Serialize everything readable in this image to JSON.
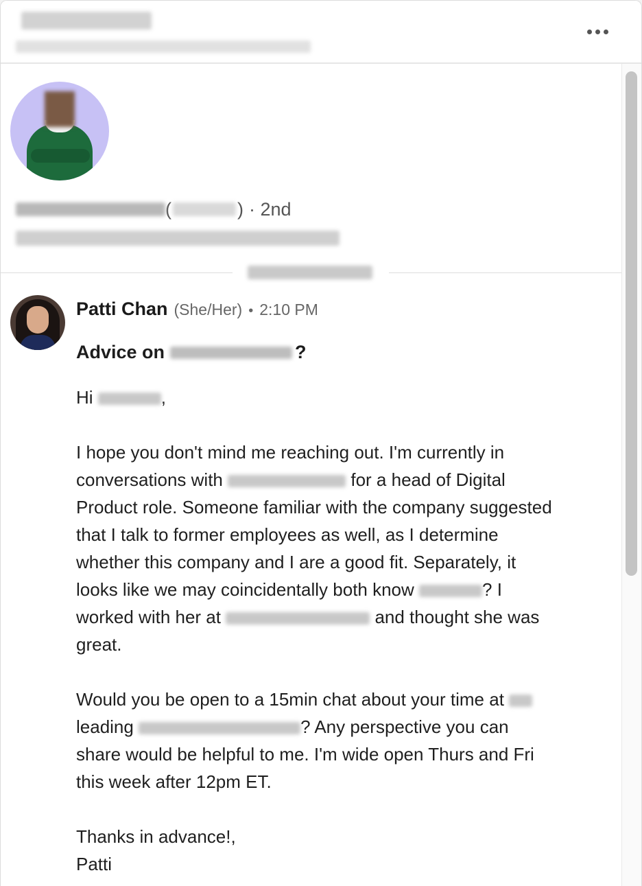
{
  "header": {
    "more_icon": "more-horizontal-icon"
  },
  "profile": {
    "degree": "· 2nd",
    "open_paren": "(",
    "close_paren": ")"
  },
  "message": {
    "sender_name": "Patti Chan",
    "sender_pronouns": "(She/Her)",
    "separator": "•",
    "time": "2:10 PM",
    "subject_prefix": "Advice on",
    "subject_suffix": "?",
    "greeting_prefix": "Hi",
    "greeting_suffix": ",",
    "p1_a": "I hope you don't mind me reaching out. I'm currently in conversations with",
    "p1_b": "for a head of Digital Product role. Someone familiar with the company suggested that I talk to former employees as well, as I determine whether this company and I are a good fit. Separately, it looks like we may coincidentally both know",
    "p1_c": "? I worked with her at",
    "p1_d": "and thought she was great.",
    "p2_a": "Would you be open to a 15min chat about your time at",
    "p2_b": "leading",
    "p2_c": "? Any perspective you can share would be helpful to me. I'm wide open Thurs and Fri this week after 12pm ET.",
    "signoff": "Thanks in advance!,",
    "signature": "Patti"
  }
}
